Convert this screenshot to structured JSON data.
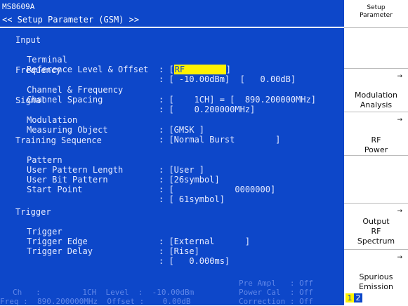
{
  "header": {
    "model": "MS8609A",
    "title": "<< Setup Parameter (GSM) >>"
  },
  "params": {
    "input_section": "Input",
    "terminal_label": "Terminal",
    "terminal_value_pre": ": [",
    "terminal_value": "RF",
    "terminal_value_post": "]",
    "ref_level_label": "Reference Level & Offset",
    "ref_level_value": ": [ -10.00dBm]  [   0.00dB]",
    "frequency_section": "Frequency",
    "channel_freq_label": "Channel & Frequency",
    "channel_freq_value": ": [    1CH] = [  890.200000MHz]",
    "channel_spacing_label": "Channel Spacing",
    "channel_spacing_value": ": [    0.200000MHz]",
    "signal_section": "Signal",
    "modulation_label": "Modulation",
    "modulation_value": ": [GMSK ]",
    "measuring_object_label": "Measuring Object",
    "measuring_object_value": ": [Normal Burst        ]",
    "training_section": "Training Sequence",
    "pattern_label": "Pattern",
    "pattern_value": ": [User ]",
    "user_pattern_length_label": "User Pattern Length",
    "user_pattern_length_value": ": [26symbol]",
    "user_bit_pattern_label": "User Bit Pattern",
    "user_bit_pattern_value": ": [            0000000]",
    "start_point_label": "Start Point",
    "start_point_value": ": [ 61symbol]",
    "trigger_section": "Trigger",
    "trigger_label": "Trigger",
    "trigger_value": ": [External      ]",
    "trigger_edge_label": "Trigger Edge",
    "trigger_edge_value": ": [Rise]",
    "trigger_delay_label": "Trigger Delay",
    "trigger_delay_value": ": [   0.000ms]"
  },
  "status": {
    "pre_ampl": "Pre Ampl   : Off",
    "ch_row": "Ch   :         1CH  Level  :  -10.00dBm",
    "power_cal": "Power Cal  : Off",
    "freq_row": "Freq :  890.200000MHz  Offset :    0.00dB",
    "correction": "Correction : Off"
  },
  "sidebar": {
    "title_line1": "Setup",
    "title_line2": "Parameter",
    "arrow": "→",
    "mod_line1": "Modulation",
    "mod_line2": "Analysis",
    "rf_line1": "RF",
    "rf_line2": "Power",
    "out_line1": "Output",
    "out_line2": "RF",
    "out_line3": "Spectrum",
    "spur_line1": "Spurious",
    "spur_line2": "Emission",
    "page1": "1",
    "page2": "2"
  },
  "colors": {
    "background": "#0d47c9",
    "highlight": "#fff200",
    "text": "#e8ecff"
  }
}
